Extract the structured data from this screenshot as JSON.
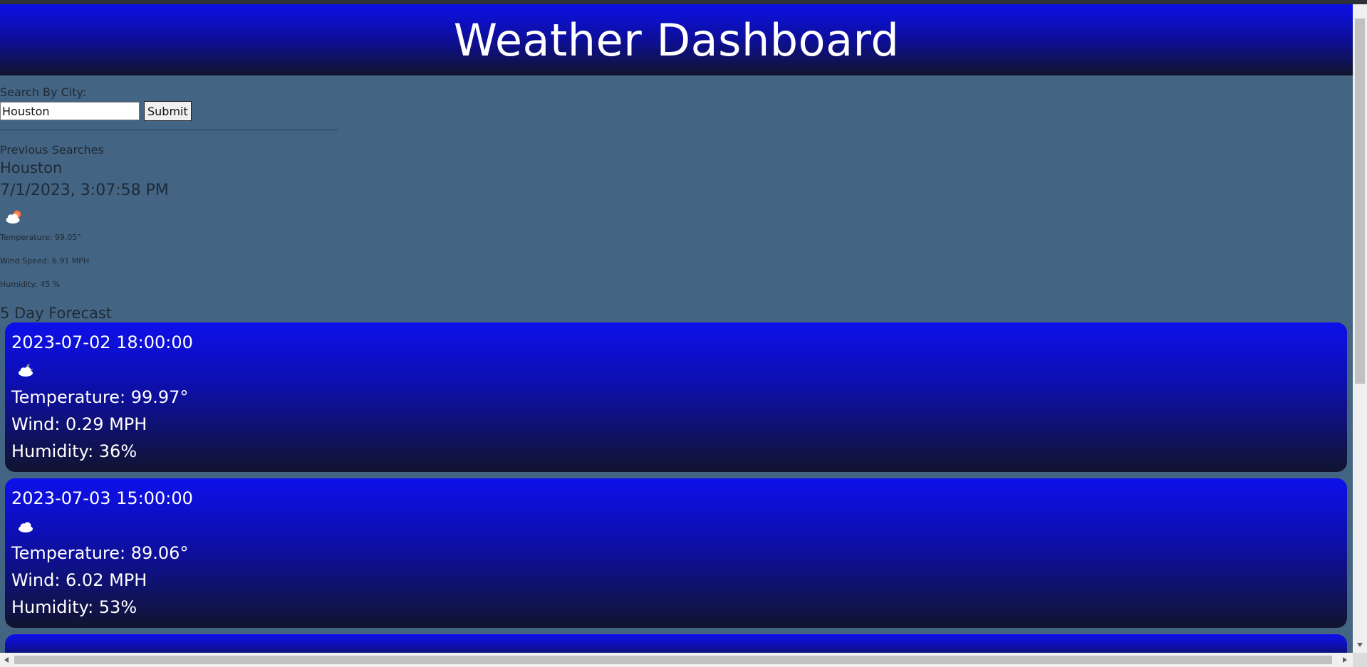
{
  "header": {
    "title": "Weather Dashboard"
  },
  "search": {
    "label": "Search By City:",
    "value": "Houston",
    "submit_label": "Submit"
  },
  "history": {
    "label": "Previous Searches",
    "items": [
      "Houston"
    ]
  },
  "current": {
    "datetime": "7/1/2023, 3:07:58 PM",
    "icon": "cloud-sun-icon",
    "temperature": "Temperature: 99.05°",
    "wind": "Wind Speed: 6.91 MPH",
    "humidity": "Humidity: 45 %"
  },
  "forecast": {
    "title": "5 Day Forecast",
    "days": [
      {
        "date": "2023-07-02 18:00:00",
        "icon": "cloud-moon-icon",
        "temperature": "Temperature: 99.97°",
        "wind": "Wind: 0.29 MPH",
        "humidity": "Humidity: 36%"
      },
      {
        "date": "2023-07-03 15:00:00",
        "icon": "cloud-icon",
        "temperature": "Temperature: 89.06°",
        "wind": "Wind: 6.02 MPH",
        "humidity": "Humidity: 53%"
      }
    ]
  },
  "colors": {
    "page_background": "#436482",
    "header_gradient_top": "#0d10e7",
    "header_gradient_bottom": "#11142b",
    "card_gradient_top": "#0d10ea",
    "card_gradient_bottom": "#11142e",
    "text_dark": "#1f2a36",
    "text_light": "#ffffff"
  }
}
